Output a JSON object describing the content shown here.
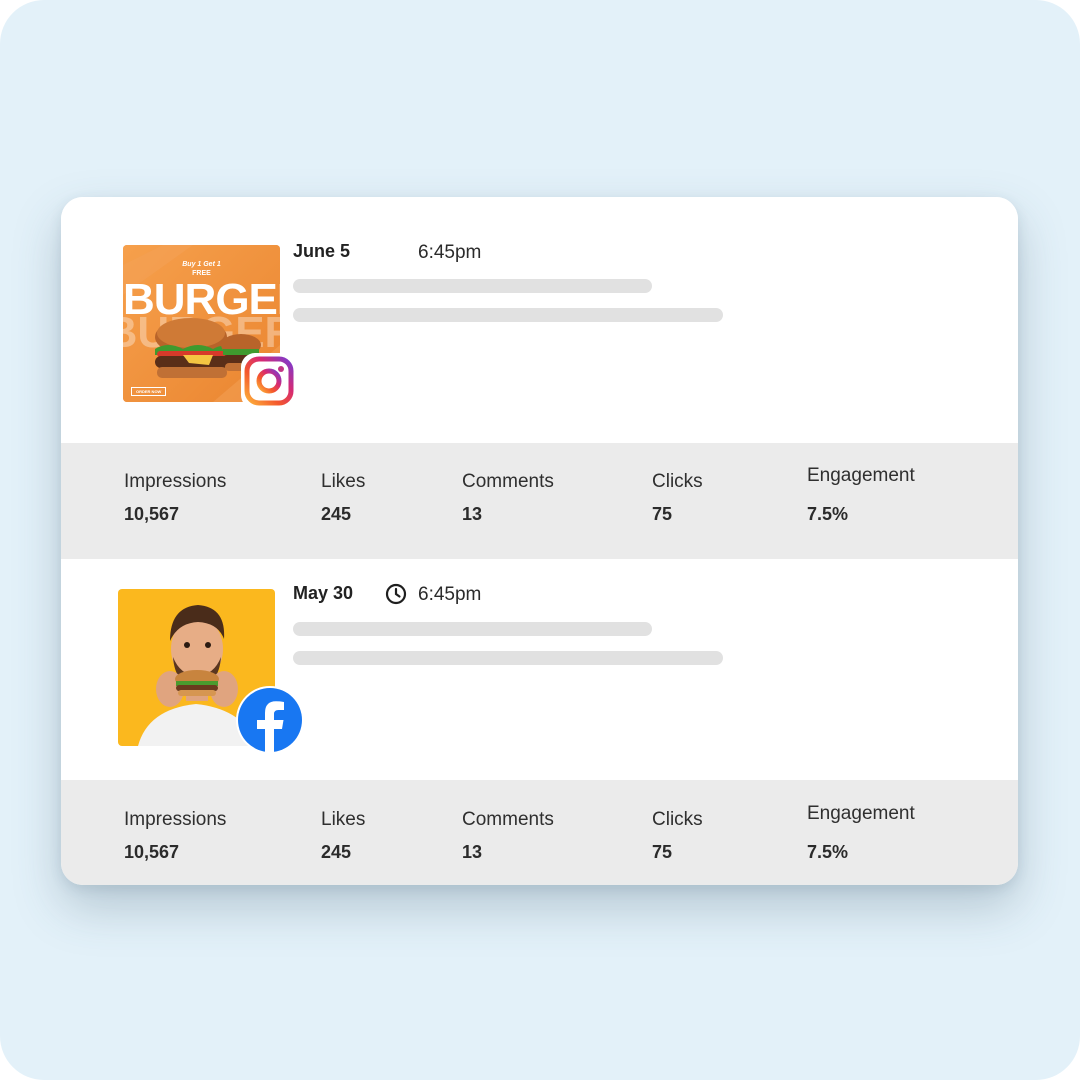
{
  "posts": [
    {
      "date": "June 5",
      "time": "6:45pm",
      "platform_icon": "instagram-icon",
      "thumbnail": {
        "top_text": "Buy 1 Get 1",
        "top_text2": "FREE",
        "headline": "BURGER",
        "cta": "ORDER NOW"
      },
      "stats": {
        "impressions_label": "Impressions",
        "impressions": "10,567",
        "likes_label": "Likes",
        "likes": "245",
        "comments_label": "Comments",
        "comments": "13",
        "clicks_label": "Clicks",
        "clicks": "75",
        "engagement_label": "Engagement",
        "engagement": "7.5%"
      }
    },
    {
      "date": "May 30",
      "time": "6:45pm",
      "time_icon": "clock-icon",
      "platform_icon": "facebook-icon",
      "stats": {
        "impressions_label": "Impressions",
        "impressions": "10,567",
        "likes_label": "Likes",
        "likes": "245",
        "comments_label": "Comments",
        "comments": "13",
        "clicks_label": "Clicks",
        "clicks": "75",
        "engagement_label": "Engagement",
        "engagement": "7.5%"
      }
    }
  ],
  "colors": {
    "background": "#e3f1f9",
    "stats_band": "#ebebeb",
    "placeholder_bar": "#e1e1e1",
    "facebook_blue": "#1877f2",
    "burger_orange": "#f0923d",
    "photo_yellow": "#fbb81e"
  }
}
